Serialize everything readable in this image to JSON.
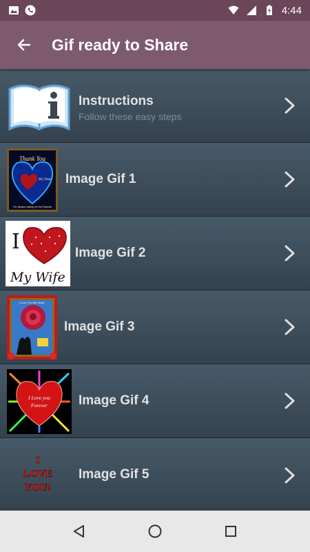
{
  "status_bar": {
    "time": "4:44",
    "left_icons": [
      "image-icon",
      "phone-icon"
    ],
    "right_icons": [
      "wifi-icon",
      "signal-icon",
      "battery-charging-icon"
    ]
  },
  "app_bar": {
    "title": "Gif ready to Share",
    "background": "#7e5a6e"
  },
  "list": {
    "items": [
      {
        "label": "Instructions",
        "subtitle": "Follow these easy steps",
        "thumb": "book-info-icon"
      },
      {
        "label": "Image Gif 1",
        "thumb": "heart-thank-you-gif",
        "thumb_text": [
          "Thank You",
          "My Dear",
          "For always making me feel Special"
        ]
      },
      {
        "label": "Image Gif 2",
        "thumb": "i-love-my-wife-gif",
        "thumb_text": [
          "I",
          "My Wife"
        ]
      },
      {
        "label": "Image Gif 3",
        "thumb": "rose-couple-gif",
        "thumb_text": [
          "I Love You My Heart"
        ]
      },
      {
        "label": "Image Gif 4",
        "thumb": "red-heart-burst-gif",
        "thumb_text": [
          "I Love you",
          "Forever"
        ]
      },
      {
        "label": "Image Gif 5",
        "thumb": "i-love-you-text-gif",
        "thumb_text": [
          "I",
          "LOVE",
          "YOU!"
        ]
      }
    ]
  },
  "nav_bar": {
    "buttons": [
      "back-triangle-icon",
      "home-circle-icon",
      "recents-square-icon"
    ]
  }
}
